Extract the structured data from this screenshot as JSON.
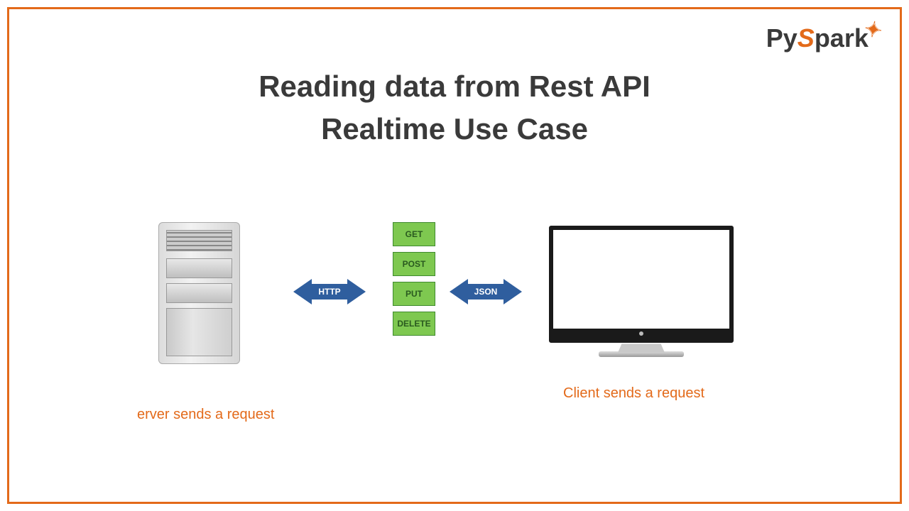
{
  "logo": {
    "py": "Py",
    "spark_s": "S",
    "spark_rest": "park",
    "star_glyph": "✦"
  },
  "title": {
    "line1": "Reading data from Rest API",
    "line2": "Realtime Use Case"
  },
  "arrows": {
    "left_label": "HTTP",
    "right_label": "JSON"
  },
  "methods": [
    "GET",
    "POST",
    "PUT",
    "DELETE"
  ],
  "captions": {
    "server": "erver sends a request",
    "client": "Client sends a request"
  },
  "colors": {
    "accent": "#e36a1a",
    "arrow": "#2f5e9e",
    "method_bg": "#7ec850"
  }
}
